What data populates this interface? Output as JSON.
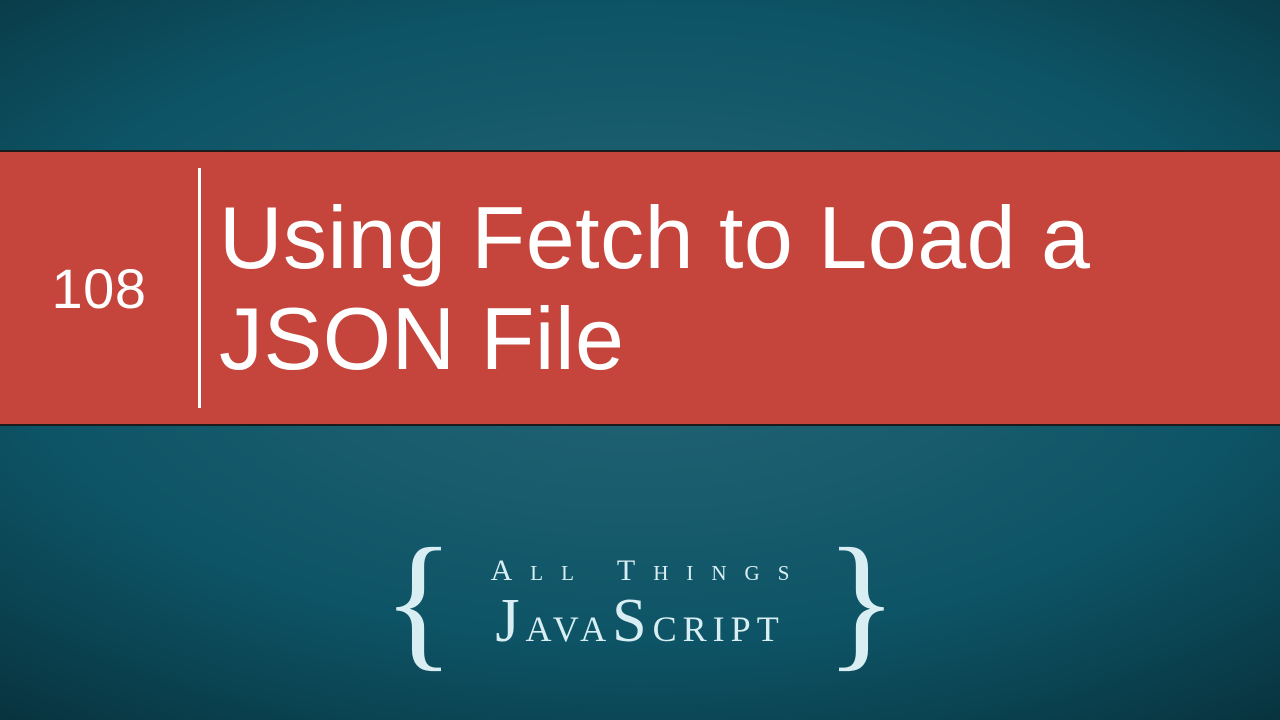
{
  "banner": {
    "number": "108",
    "title": "Using Fetch to Load a JSON File"
  },
  "logo": {
    "brace_left": "{",
    "brace_right": "}",
    "line1": "All Things",
    "line2_cap1": "J",
    "line2_part1": "ava",
    "line2_cap2": "S",
    "line2_part2": "cript"
  },
  "colors": {
    "background": "#0d5466",
    "banner": "#c5443b",
    "text": "#ffffff",
    "logo_text": "#d9eef3"
  }
}
